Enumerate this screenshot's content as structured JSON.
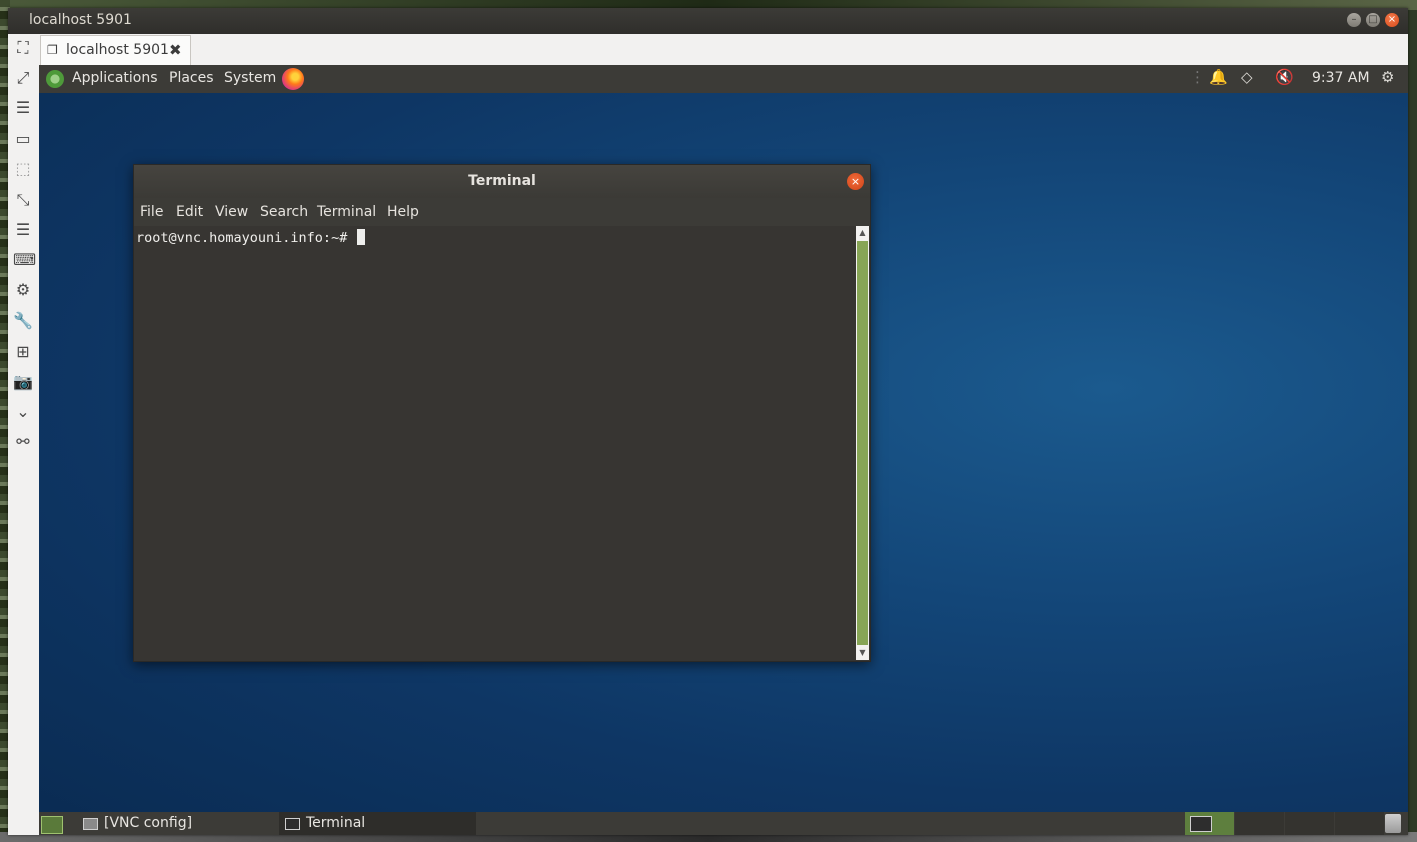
{
  "window": {
    "title": "localhost 5901",
    "controls": {
      "minimize": "–",
      "maximize": "□",
      "close": "×"
    }
  },
  "tab": {
    "label": "localhost 5901",
    "close_glyph": "✖"
  },
  "toolbar_icons": [
    "focus-mode-icon",
    "fullscreen-icon",
    "menu-icon",
    "window-icon",
    "scaled-icon",
    "resize-icon",
    "more-menu-icon",
    "keyboard-icon",
    "preferences-icon",
    "tools-icon",
    "new-connection-icon",
    "screenshot-icon",
    "chevron-down-icon",
    "disconnect-icon"
  ],
  "remote_desktop": {
    "top_panel": {
      "menus": [
        "Applications",
        "Places",
        "System"
      ],
      "clock": "9:37 AM"
    },
    "terminal_window": {
      "title": "Terminal",
      "close_glyph": "×",
      "menu": [
        "File",
        "Edit",
        "View",
        "Search",
        "Terminal",
        "Help"
      ],
      "prompt": "root@vnc.homayouni.info:~# "
    },
    "bottom_panel": {
      "tasks": [
        "[VNC config]",
        "Terminal"
      ]
    }
  }
}
